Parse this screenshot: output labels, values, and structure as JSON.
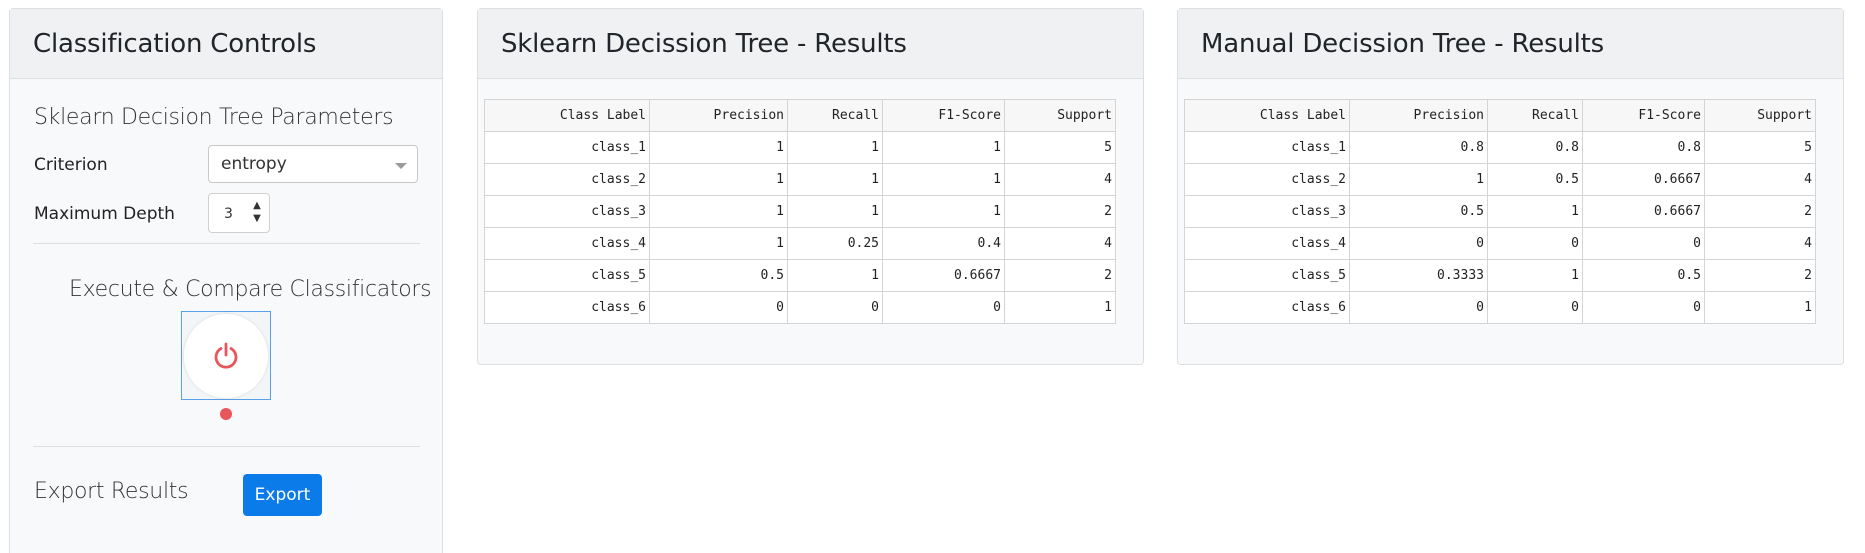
{
  "controls": {
    "title": "Classification Controls",
    "params_title": "Sklearn Decision Tree Parameters",
    "criterion_label": "Criterion",
    "criterion_value": "entropy",
    "max_depth_label": "Maximum Depth",
    "max_depth_value": "3",
    "execute_title": "Execute & Compare Classificators",
    "export_title": "Export Results",
    "export_button": "Export",
    "colors": {
      "accent": "#0b7bea",
      "power": "#e8565c"
    },
    "icons": {
      "power": "power-icon",
      "spin_up": "chevron-up-icon",
      "spin_down": "chevron-down-icon"
    }
  },
  "sklearn": {
    "title": "Sklearn Decission Tree - Results",
    "columns": [
      "Class Label",
      "Precision",
      "Recall",
      "F1-Score",
      "Support"
    ],
    "rows": [
      [
        "class_1",
        "1",
        "1",
        "1",
        "5"
      ],
      [
        "class_2",
        "1",
        "1",
        "1",
        "4"
      ],
      [
        "class_3",
        "1",
        "1",
        "1",
        "2"
      ],
      [
        "class_4",
        "1",
        "0.25",
        "0.4",
        "4"
      ],
      [
        "class_5",
        "0.5",
        "1",
        "0.6667",
        "2"
      ],
      [
        "class_6",
        "0",
        "0",
        "0",
        "1"
      ]
    ]
  },
  "manual": {
    "title": "Manual Decission Tree - Results",
    "columns": [
      "Class Label",
      "Precision",
      "Recall",
      "F1-Score",
      "Support"
    ],
    "rows": [
      [
        "class_1",
        "0.8",
        "0.8",
        "0.8",
        "5"
      ],
      [
        "class_2",
        "1",
        "0.5",
        "0.6667",
        "4"
      ],
      [
        "class_3",
        "0.5",
        "1",
        "0.6667",
        "2"
      ],
      [
        "class_4",
        "0",
        "0",
        "0",
        "4"
      ],
      [
        "class_5",
        "0.3333",
        "1",
        "0.5",
        "2"
      ],
      [
        "class_6",
        "0",
        "0",
        "0",
        "1"
      ]
    ]
  }
}
